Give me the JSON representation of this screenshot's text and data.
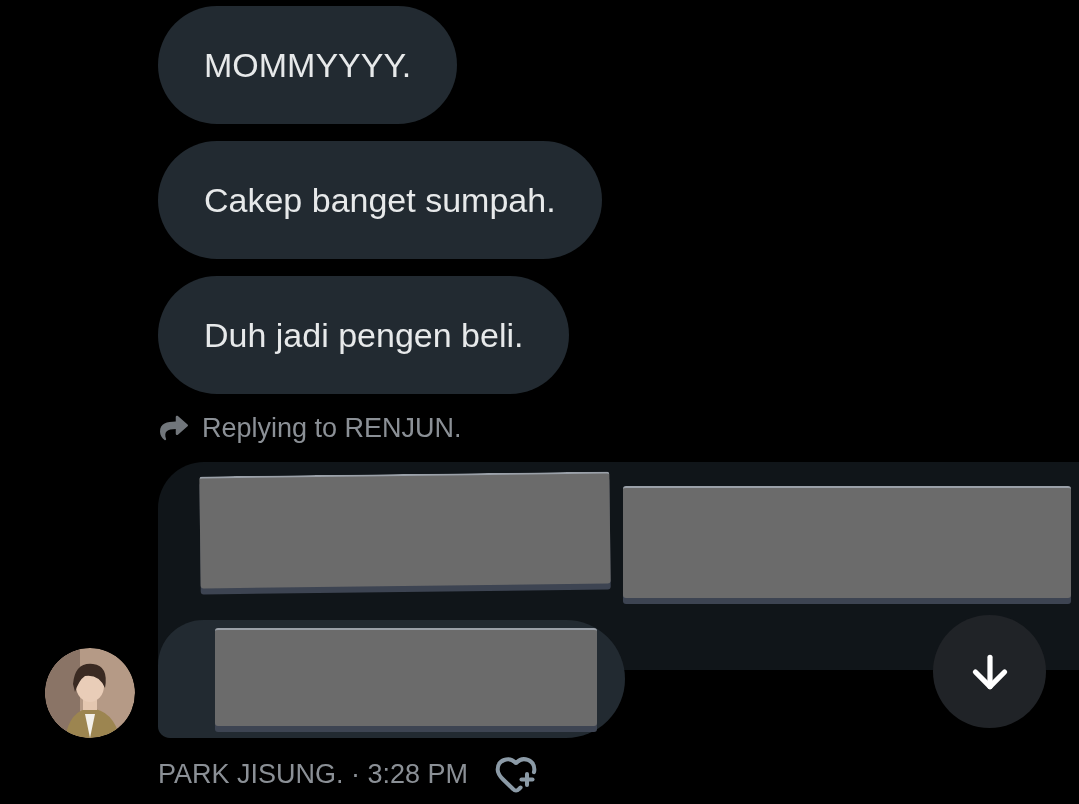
{
  "messages": [
    {
      "text": "MOMMYYYY."
    },
    {
      "text": "Cakep banget sumpah."
    },
    {
      "text": "Duh jadi pengen beli."
    }
  ],
  "reply_context": {
    "label": "Replying to RENJUN."
  },
  "sender_line": {
    "text": "PARK JISUNG. · 3:28 PM"
  }
}
